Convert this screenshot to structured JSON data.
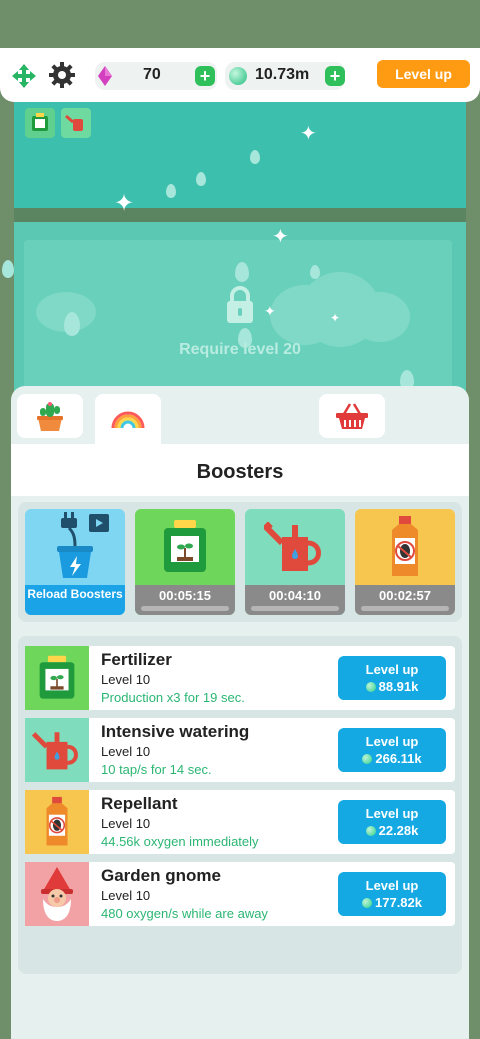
{
  "topbar": {
    "gems": "70",
    "oxygen": "10.73m",
    "level_up_label": "Level up",
    "gem_icon": "pink-gem-icon",
    "oxygen_icon": "oxygen-orb-icon"
  },
  "scene": {
    "locked_text": "Require level 20"
  },
  "tabs": [
    {
      "icon": "cactus-pot-icon"
    },
    {
      "icon": "rainbow-icon"
    },
    {
      "icon": "basket-icon"
    }
  ],
  "panel": {
    "title": "Boosters"
  },
  "boosters": [
    {
      "label": "Reload Boosters",
      "icon": "plant-plug-icon"
    },
    {
      "timer": "00:05:15",
      "icon": "fertilizer-icon"
    },
    {
      "timer": "00:04:10",
      "icon": "watering-can-icon"
    },
    {
      "timer": "00:02:57",
      "icon": "repellant-icon"
    }
  ],
  "items": [
    {
      "name": "Fertilizer",
      "level": "Level 10",
      "desc": "Production x3 for 19 sec.",
      "btn": "Level up",
      "cost": "88.91k"
    },
    {
      "name": "Intensive watering",
      "level": "Level 10",
      "desc": "10 tap/s for 14 sec.",
      "btn": "Level up",
      "cost": "266.11k"
    },
    {
      "name": "Repellant",
      "level": "Level 10",
      "desc": "44.56k oxygen immediately",
      "btn": "Level up",
      "cost": "22.28k"
    },
    {
      "name": "Garden gnome",
      "level": "Level 10",
      "desc": "480 oxygen/s while are away",
      "btn": "Level up",
      "cost": "177.82k"
    }
  ],
  "colors": {
    "accent_orange": "#ff9b12",
    "button_blue": "#14a9e3",
    "desc_green": "#2bb673",
    "teal": "#3dbfae"
  }
}
